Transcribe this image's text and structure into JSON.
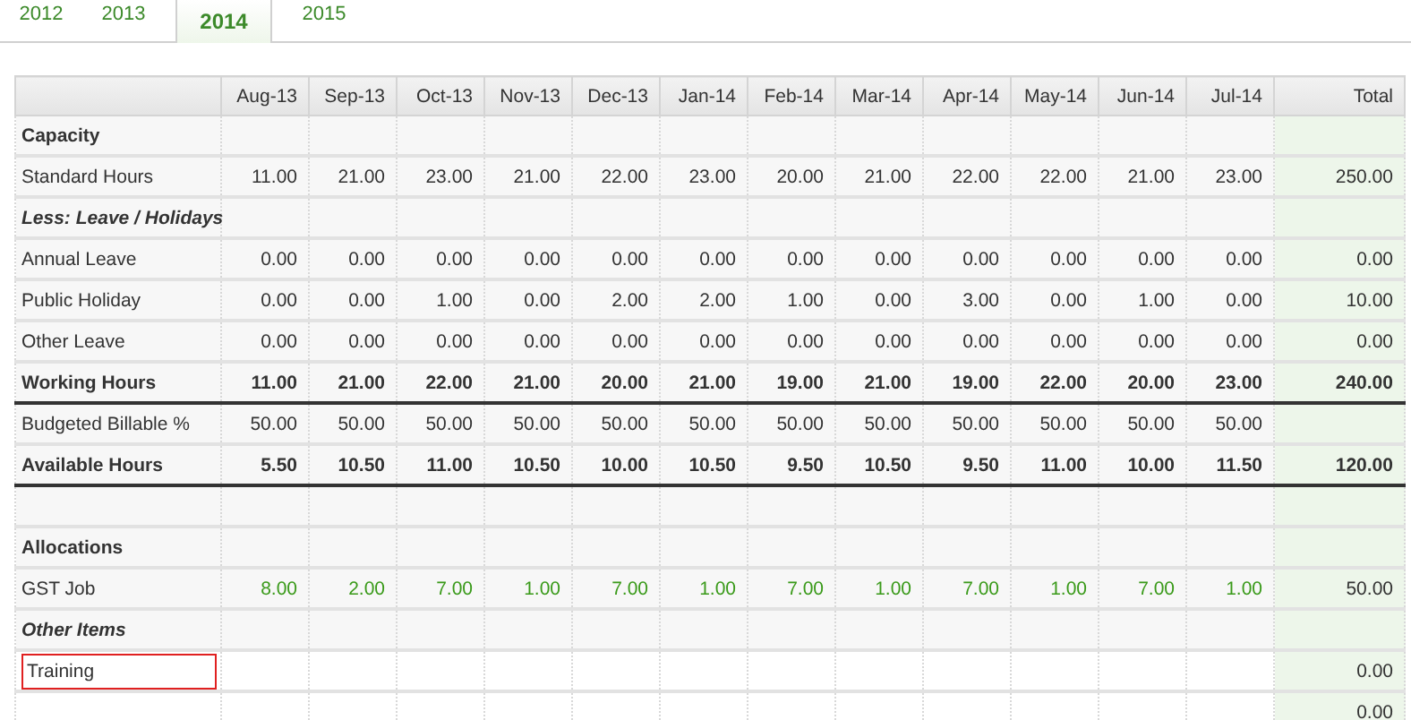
{
  "tabs": [
    {
      "label": "2012",
      "selected": false
    },
    {
      "label": "2013",
      "selected": false
    },
    {
      "label": "2014",
      "selected": true
    },
    {
      "label": "2015",
      "selected": false
    }
  ],
  "table": {
    "columns": [
      "Aug-13",
      "Sep-13",
      "Oct-13",
      "Nov-13",
      "Dec-13",
      "Jan-14",
      "Feb-14",
      "Mar-14",
      "Apr-14",
      "May-14",
      "Jun-14",
      "Jul-14"
    ],
    "total_label": "Total",
    "rows": [
      {
        "kind": "heading",
        "label": "Capacity"
      },
      {
        "kind": "data",
        "label": "Standard Hours",
        "values": [
          "11.00",
          "21.00",
          "23.00",
          "21.00",
          "22.00",
          "23.00",
          "20.00",
          "21.00",
          "22.00",
          "22.00",
          "21.00",
          "23.00"
        ],
        "total": "250.00"
      },
      {
        "kind": "subheading",
        "label": "Less: Leave / Holidays"
      },
      {
        "kind": "data",
        "label": "Annual Leave",
        "values": [
          "0.00",
          "0.00",
          "0.00",
          "0.00",
          "0.00",
          "0.00",
          "0.00",
          "0.00",
          "0.00",
          "0.00",
          "0.00",
          "0.00"
        ],
        "total": "0.00"
      },
      {
        "kind": "data",
        "label": "Public Holiday",
        "values": [
          "0.00",
          "0.00",
          "1.00",
          "0.00",
          "2.00",
          "2.00",
          "1.00",
          "0.00",
          "3.00",
          "0.00",
          "1.00",
          "0.00"
        ],
        "total": "10.00"
      },
      {
        "kind": "data",
        "label": "Other Leave",
        "values": [
          "0.00",
          "0.00",
          "0.00",
          "0.00",
          "0.00",
          "0.00",
          "0.00",
          "0.00",
          "0.00",
          "0.00",
          "0.00",
          "0.00"
        ],
        "total": "0.00"
      },
      {
        "kind": "sum",
        "label": "Working Hours",
        "values": [
          "11.00",
          "21.00",
          "22.00",
          "21.00",
          "20.00",
          "21.00",
          "19.00",
          "21.00",
          "19.00",
          "22.00",
          "20.00",
          "23.00"
        ],
        "total": "240.00"
      },
      {
        "kind": "data",
        "label": "Budgeted Billable %",
        "values": [
          "50.00",
          "50.00",
          "50.00",
          "50.00",
          "50.00",
          "50.00",
          "50.00",
          "50.00",
          "50.00",
          "50.00",
          "50.00",
          "50.00"
        ]
      },
      {
        "kind": "sum",
        "label": "Available Hours",
        "values": [
          "5.50",
          "10.50",
          "11.00",
          "10.50",
          "10.00",
          "10.50",
          "9.50",
          "10.50",
          "9.50",
          "11.00",
          "10.00",
          "11.50"
        ],
        "total": "120.00"
      },
      {
        "kind": "blank"
      },
      {
        "kind": "heading",
        "label": "Allocations"
      },
      {
        "kind": "allocation",
        "label": "GST Job",
        "values": [
          "8.00",
          "2.00",
          "7.00",
          "1.00",
          "7.00",
          "1.00",
          "7.00",
          "1.00",
          "7.00",
          "1.00",
          "7.00",
          "1.00"
        ],
        "total": "50.00"
      },
      {
        "kind": "subheading",
        "label": "Other Items"
      },
      {
        "kind": "input",
        "label": "Training",
        "highlighted": true,
        "total": "0.00"
      },
      {
        "kind": "input",
        "total": "0.00"
      }
    ]
  }
}
